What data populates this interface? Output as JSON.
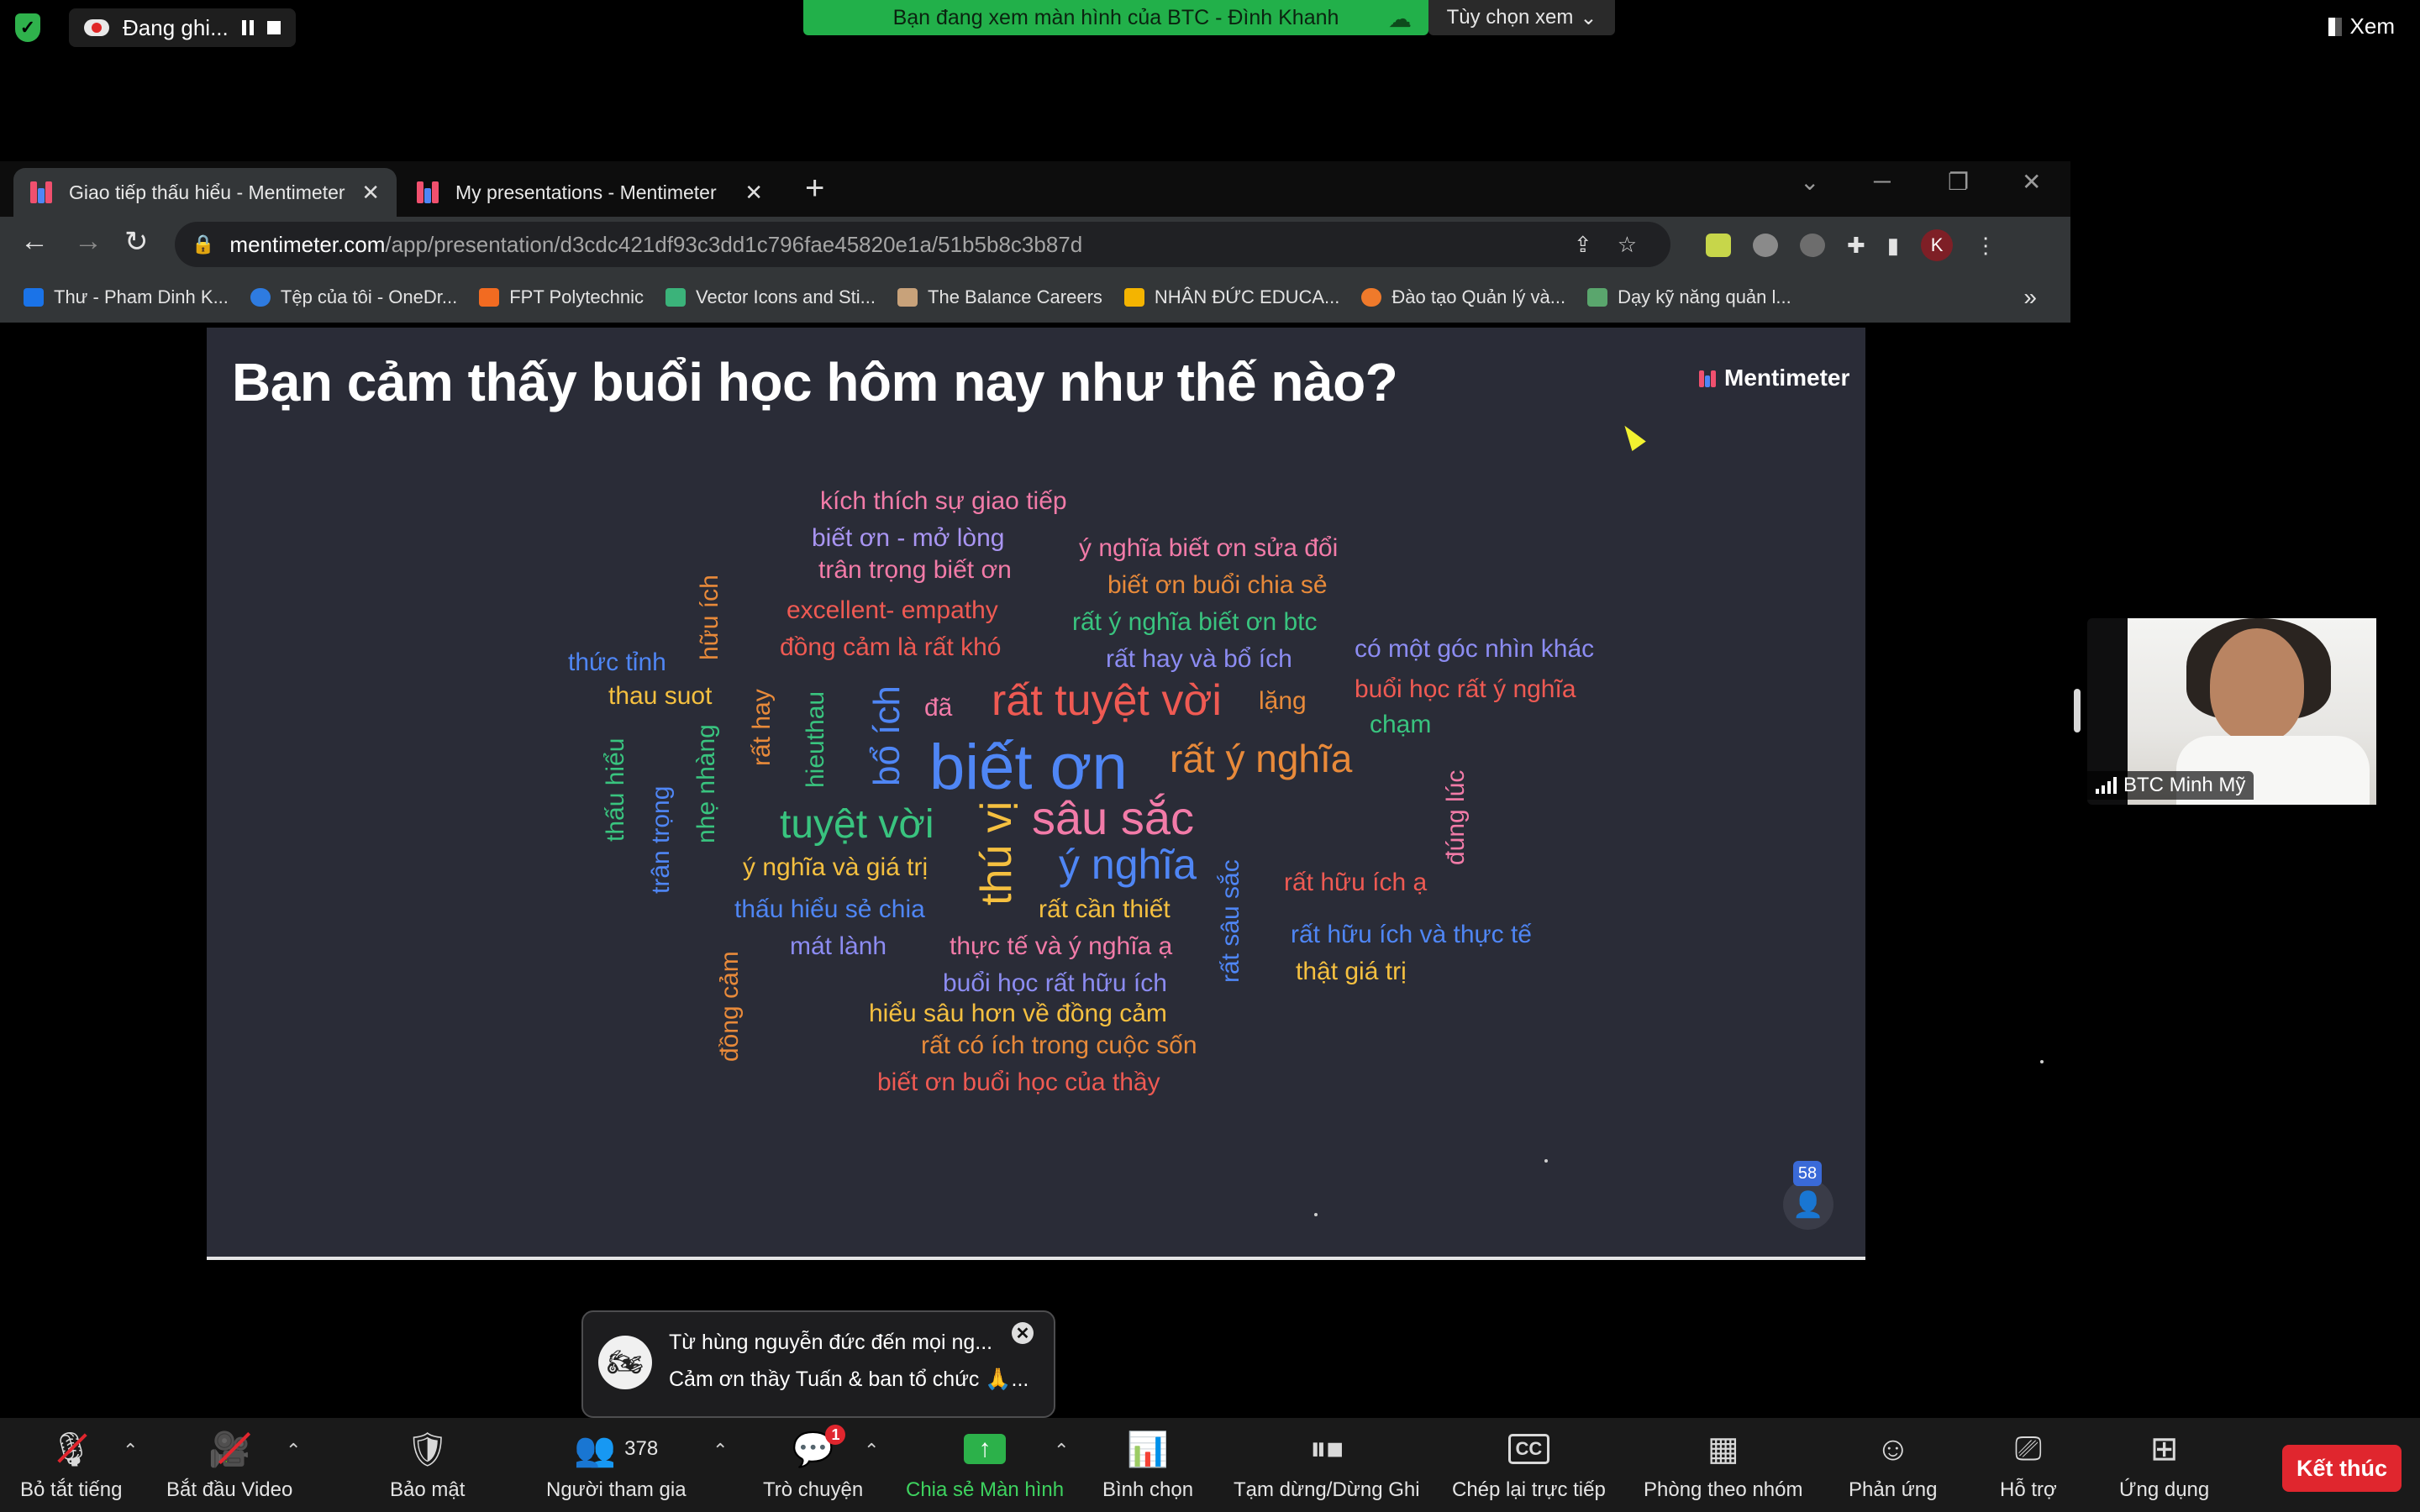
{
  "zoom_top": {
    "recording_label": "Đang ghi...",
    "share_banner": "Bạn đang xem màn hình của BTC - Đình Khanh",
    "view_options": "Tùy chọn xem",
    "view_right": "Xem"
  },
  "browser": {
    "tabs": [
      {
        "label": "Giao tiếp thấu hiểu - Mentimeter",
        "active": true
      },
      {
        "label": "My presentations - Mentimeter",
        "active": false
      }
    ],
    "url_host": "mentimeter.com",
    "url_path": "/app/presentation/d3cdc421df93c3dd1c796fae45820e1a/51b5b8c3b87d",
    "profile_initial": "K",
    "bookmarks": [
      "Thư - Pham Dinh K...",
      "Tệp của tôi - OneDr...",
      "FPT Polytechnic",
      "Vector Icons and Sti...",
      "The Balance Careers",
      "NHÂN ĐỨC EDUCA...",
      "Đào tạo Quản lý và...",
      "Dạy kỹ năng quản l..."
    ]
  },
  "slide": {
    "title": "Bạn cảm thấy buổi học hôm nay như thế nào?",
    "brand": "Mentimeter",
    "response_count": "58",
    "words": [
      {
        "text": "kích thích sự giao tiếp",
        "color": "#f27ba8"
      },
      {
        "text": "biết ơn - mở lòng",
        "color": "#a995f2"
      },
      {
        "text": "trân trọng biết ơn",
        "color": "#f27ba8"
      },
      {
        "text": "ý nghĩa biết ơn sửa đổi",
        "color": "#f27ba8"
      },
      {
        "text": "biết ơn buổi chia sẻ",
        "color": "#e88a3a"
      },
      {
        "text": "excellent- empathy",
        "color": "#ef5a53"
      },
      {
        "text": "rất ý nghĩa biết ơn btc",
        "color": "#39c47f"
      },
      {
        "text": "đồng cảm là rất khó",
        "color": "#ef5a53"
      },
      {
        "text": "rất hay và bổ ích",
        "color": "#8c8cf2"
      },
      {
        "text": "có một góc nhìn khác",
        "color": "#8c8cf2"
      },
      {
        "text": "thức tỉnh",
        "color": "#4f86f5"
      },
      {
        "text": "thau suot",
        "color": "#f5c040"
      },
      {
        "text": "đã",
        "color": "#f27ba8"
      },
      {
        "text": "rất tuyệt vời",
        "color": "#ef5a53"
      },
      {
        "text": "lặng",
        "color": "#e88a3a"
      },
      {
        "text": "buổi học rất ý nghĩa",
        "color": "#ef5a53"
      },
      {
        "text": "chạm",
        "color": "#39c47f"
      },
      {
        "text": "biết ơn",
        "color": "#4f86f5"
      },
      {
        "text": "rất ý nghĩa",
        "color": "#e88a3a"
      },
      {
        "text": "tuyệt vời",
        "color": "#39c47f"
      },
      {
        "text": "sâu sắc",
        "color": "#f27ba8"
      },
      {
        "text": "ý nghĩa và giá trị",
        "color": "#f5c040"
      },
      {
        "text": "ý nghĩa",
        "color": "#4f86f5"
      },
      {
        "text": "thấu hiểu sẻ chia",
        "color": "#4f86f5"
      },
      {
        "text": "rất cần thiết",
        "color": "#f5c040"
      },
      {
        "text": "rất hữu ích ạ",
        "color": "#ef5a53"
      },
      {
        "text": "mát lành",
        "color": "#8c8cf2"
      },
      {
        "text": "thực tế và ý nghĩa ạ",
        "color": "#f27ba8"
      },
      {
        "text": "rất hữu ích và thực tế",
        "color": "#4f86f5"
      },
      {
        "text": "buổi học rất hữu ích",
        "color": "#8c8cf2"
      },
      {
        "text": "thật giá trị",
        "color": "#f5c040"
      },
      {
        "text": "hiểu sâu hơn về đồng cảm",
        "color": "#f5c040"
      },
      {
        "text": "rất có ích trong cuộc sốn",
        "color": "#e88a3a"
      },
      {
        "text": "biết ơn buổi học của thầy",
        "color": "#ef5a53"
      },
      {
        "text": "hữu ích",
        "color": "#e88a3a"
      },
      {
        "text": "rất hay",
        "color": "#e88a3a"
      },
      {
        "text": "hieuthau",
        "color": "#39c47f"
      },
      {
        "text": "bổ ích",
        "color": "#4f86f5"
      },
      {
        "text": "thấu hiểu",
        "color": "#39c47f"
      },
      {
        "text": "trân trọng",
        "color": "#4f86f5"
      },
      {
        "text": "nhẹ nhàng",
        "color": "#39c47f"
      },
      {
        "text": "thú vị",
        "color": "#f5c040"
      },
      {
        "text": "đồng cảm",
        "color": "#e88a3a"
      },
      {
        "text": "rất sâu sắc",
        "color": "#4f86f5"
      },
      {
        "text": "đúng lúc",
        "color": "#f27ba8"
      }
    ]
  },
  "participant": {
    "name": "BTC Minh Mỹ"
  },
  "chat": {
    "sender": "Từ hùng nguyễn đức đến mọi ng...",
    "message": "Cảm ơn thầy Tuấn & ban tổ chức 🙏..."
  },
  "zoom_bar": {
    "mute": "Bỏ tắt tiếng",
    "video": "Bắt đầu Video",
    "security": "Bảo mật",
    "participants": "Người tham gia",
    "participant_count": "378",
    "chat": "Trò chuyện",
    "chat_badge": "1",
    "share": "Chia sẻ Màn hình",
    "poll": "Bình chọn",
    "pause_record": "Tạm dừng/Dừng Ghi",
    "caption": "Chép lại trực tiếp",
    "breakout": "Phòng theo nhóm",
    "reactions": "Phản ứng",
    "support": "Hỗ trợ",
    "apps": "Ứng dụng",
    "end": "Kết thúc"
  }
}
